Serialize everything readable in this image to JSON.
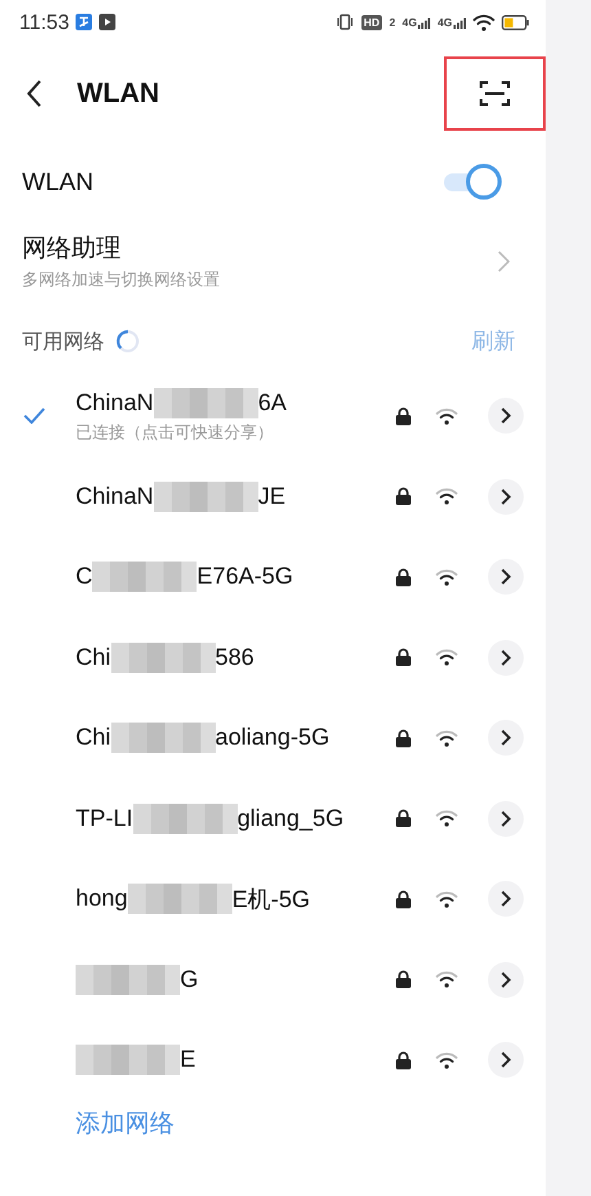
{
  "status_bar": {
    "time": "11:53",
    "hd_label": "HD",
    "sim_slot": "2",
    "networks": [
      "4G",
      "4G"
    ]
  },
  "header": {
    "title": "WLAN",
    "highlighted_action": true
  },
  "wlan": {
    "label": "WLAN",
    "on": true
  },
  "assistant": {
    "title": "网络助理",
    "subtitle": "多网络加速与切换网络设置"
  },
  "available": {
    "label": "可用网络",
    "scanning": true,
    "refresh": {
      "label": "刷新",
      "disabled": true
    }
  },
  "networks": [
    {
      "name_start": "ChinaN",
      "name_end": "6A",
      "connected": true,
      "status": "已连接（点击可快速分享）"
    },
    {
      "name_start": "ChinaN",
      "name_end": "JE",
      "connected": false
    },
    {
      "name_start": "C",
      "name_end": "E76A-5G",
      "connected": false
    },
    {
      "name_start": "Chi",
      "name_end": "586",
      "connected": false
    },
    {
      "name_start": "Chi",
      "name_end": "aoliang-5G",
      "connected": false
    },
    {
      "name_start": "TP-LI",
      "name_end": "gliang_5G",
      "connected": false
    },
    {
      "name_start": "hong",
      "name_end": "E机-5G",
      "connected": false
    },
    {
      "name_end": "G",
      "connected": false
    },
    {
      "name_end": "E",
      "connected": false
    }
  ],
  "add_network": "添加网络"
}
